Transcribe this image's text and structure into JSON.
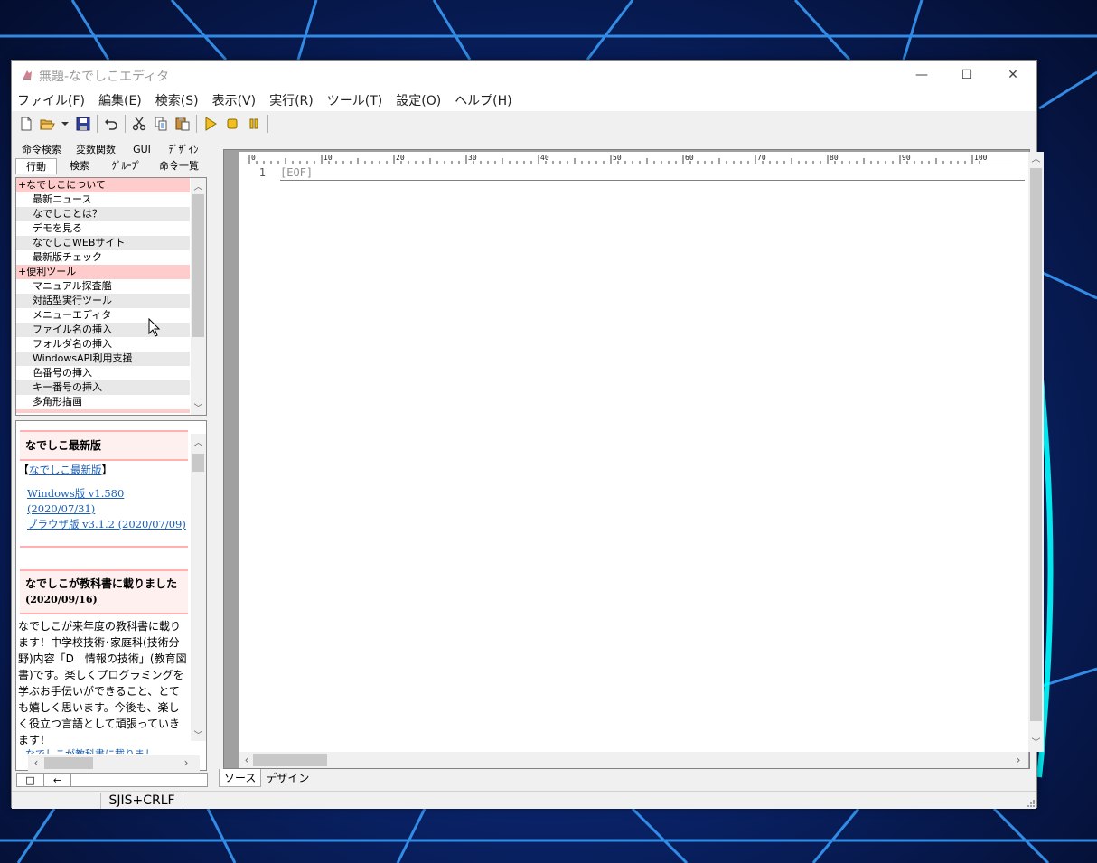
{
  "window": {
    "title": "無題-なでしこエディタ",
    "min_glyph": "—",
    "max_glyph": "☐",
    "close_glyph": "✕"
  },
  "menu": [
    "ファイル(F)",
    "編集(E)",
    "検索(S)",
    "表示(V)",
    "実行(R)",
    "ツール(T)",
    "設定(O)",
    "ヘルプ(H)"
  ],
  "left_tabs": {
    "top": [
      "命令検索",
      "変数関数",
      "GUI",
      "ﾃﾞｻﾞｲﾝ"
    ],
    "bottom": [
      "行動",
      "検索",
      "ｸﾞﾙｰﾌﾟ",
      "命令一覧"
    ]
  },
  "command_list": [
    {
      "type": "category",
      "label": "+なでしこについて"
    },
    {
      "type": "item",
      "label": "最新ニュース"
    },
    {
      "type": "item",
      "label": "なでしことは？"
    },
    {
      "type": "item",
      "label": "デモを見る"
    },
    {
      "type": "item",
      "label": "なでしこWEBサイト"
    },
    {
      "type": "item",
      "label": "最新版チェック"
    },
    {
      "type": "category",
      "label": "+便利ツール"
    },
    {
      "type": "item",
      "label": "マニュアル探査艦"
    },
    {
      "type": "item",
      "label": "対話型実行ツール"
    },
    {
      "type": "item",
      "label": "メニューエディタ"
    },
    {
      "type": "item",
      "label": "ファイル名の挿入"
    },
    {
      "type": "item",
      "label": "フォルダ名の挿入"
    },
    {
      "type": "item",
      "label": "WindowsAPI利用支援"
    },
    {
      "type": "item",
      "label": "色番号の挿入"
    },
    {
      "type": "item",
      "label": "キー番号の挿入"
    },
    {
      "type": "item",
      "label": "多角形描画"
    }
  ],
  "news": {
    "heading1": "なでしこ最新版",
    "bracket_open": "【",
    "link_latest": "なでしこ最新版",
    "bracket_close": "】",
    "win_link_1": "Windows版 v1.580",
    "win_link_2": "(2020/07/31)",
    "browser_link": "ブラウザ版 v3.1.2 (2020/07/09)",
    "heading2": "なでしこが教科書に載りました",
    "heading2_date": "(2020/09/16)",
    "body": "なでしこが来年度の教科書に載ります！中学校技術･家庭科(技術分野)内容「D　情報の技術」(教育図書)です。楽しくプログラミングを学ぶお手伝いができること、とても嬉しく思います。今後も、楽しく役立つ言語として頑張っていきます！",
    "next_link": "なでしこが教科書に載りまし"
  },
  "bottom_buttons": [
    "□",
    "←"
  ],
  "ruler_numbers": [
    "0",
    "10",
    "20",
    "30",
    "40",
    "50",
    "60",
    "70",
    "80",
    "90",
    "100"
  ],
  "editor": {
    "line_number": "1",
    "eof": "[EOF]"
  },
  "editor_tabs": [
    "ソース",
    "デザイン"
  ],
  "status": {
    "encoding": "SJIS+CRLF"
  }
}
